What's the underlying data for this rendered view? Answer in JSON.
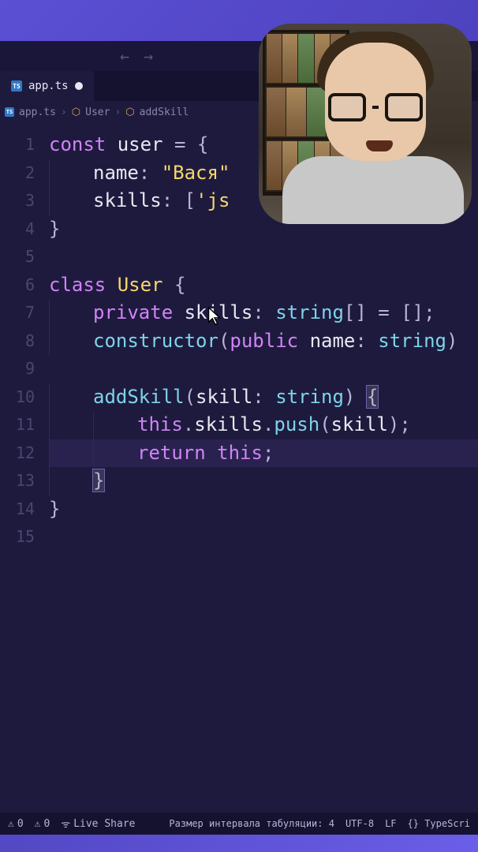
{
  "tab": {
    "filename": "app.ts",
    "icon_label": "TS"
  },
  "breadcrumb": {
    "file": "app.ts",
    "class": "User",
    "method": "addSkill"
  },
  "code": {
    "lines": [
      {
        "n": 1,
        "tokens": [
          [
            "kw",
            "const"
          ],
          [
            "sp",
            " "
          ],
          [
            "var",
            "user"
          ],
          [
            "sp",
            " "
          ],
          [
            "op",
            "="
          ],
          [
            "sp",
            " "
          ],
          [
            "punc",
            "{"
          ]
        ]
      },
      {
        "n": 2,
        "indent": 1,
        "tokens": [
          [
            "prop",
            "name"
          ],
          [
            "punc",
            ":"
          ],
          [
            "sp",
            " "
          ],
          [
            "str",
            "\"Вася\""
          ]
        ]
      },
      {
        "n": 3,
        "indent": 1,
        "tokens": [
          [
            "prop",
            "skills"
          ],
          [
            "punc",
            ":"
          ],
          [
            "sp",
            " "
          ],
          [
            "punc",
            "["
          ],
          [
            "str",
            "'js"
          ]
        ]
      },
      {
        "n": 4,
        "tokens": [
          [
            "punc",
            "}"
          ]
        ]
      },
      {
        "n": 5,
        "tokens": []
      },
      {
        "n": 6,
        "tokens": [
          [
            "kw",
            "class"
          ],
          [
            "sp",
            " "
          ],
          [
            "cls",
            "User"
          ],
          [
            "sp",
            " "
          ],
          [
            "punc",
            "{"
          ]
        ]
      },
      {
        "n": 7,
        "indent": 1,
        "tokens": [
          [
            "mod",
            "private"
          ],
          [
            "sp",
            " "
          ],
          [
            "prop",
            "skills"
          ],
          [
            "punc",
            ":"
          ],
          [
            "sp",
            " "
          ],
          [
            "type",
            "string"
          ],
          [
            "punc",
            "[]"
          ],
          [
            "sp",
            " "
          ],
          [
            "op",
            "="
          ],
          [
            "sp",
            " "
          ],
          [
            "punc",
            "[];"
          ]
        ]
      },
      {
        "n": 8,
        "indent": 1,
        "tokens": [
          [
            "fn",
            "constructor"
          ],
          [
            "punc",
            "("
          ],
          [
            "mod",
            "public"
          ],
          [
            "sp",
            " "
          ],
          [
            "var",
            "name"
          ],
          [
            "punc",
            ":"
          ],
          [
            "sp",
            " "
          ],
          [
            "type",
            "string"
          ],
          [
            "punc",
            ")"
          ]
        ]
      },
      {
        "n": 9,
        "tokens": []
      },
      {
        "n": 10,
        "indent": 1,
        "tokens": [
          [
            "fn",
            "addSkill"
          ],
          [
            "punc",
            "("
          ],
          [
            "var",
            "skill"
          ],
          [
            "punc",
            ":"
          ],
          [
            "sp",
            " "
          ],
          [
            "type",
            "string"
          ],
          [
            "punc",
            ")"
          ],
          [
            "sp",
            " "
          ],
          [
            "punc-m",
            "{"
          ]
        ]
      },
      {
        "n": 11,
        "indent": 2,
        "tokens": [
          [
            "kw",
            "this"
          ],
          [
            "punc",
            "."
          ],
          [
            "prop",
            "skills"
          ],
          [
            "punc",
            "."
          ],
          [
            "fn",
            "push"
          ],
          [
            "punc",
            "("
          ],
          [
            "var",
            "skill"
          ],
          [
            "punc",
            ");"
          ]
        ]
      },
      {
        "n": 12,
        "indent": 2,
        "hl": true,
        "tokens": [
          [
            "kw",
            "return"
          ],
          [
            "sp",
            " "
          ],
          [
            "kw",
            "this"
          ],
          [
            "punc",
            ";"
          ]
        ]
      },
      {
        "n": 13,
        "indent": 1,
        "tokens": [
          [
            "punc-m",
            "}"
          ]
        ]
      },
      {
        "n": 14,
        "tokens": [
          [
            "punc",
            "}"
          ]
        ]
      },
      {
        "n": 15,
        "tokens": []
      }
    ]
  },
  "statusbar": {
    "errors": "0",
    "warnings": "0",
    "liveshare": "Live Share",
    "tabsize": "Размер интервала табуляции: 4",
    "encoding": "UTF-8",
    "eol": "LF",
    "lang": "TypeScri"
  }
}
